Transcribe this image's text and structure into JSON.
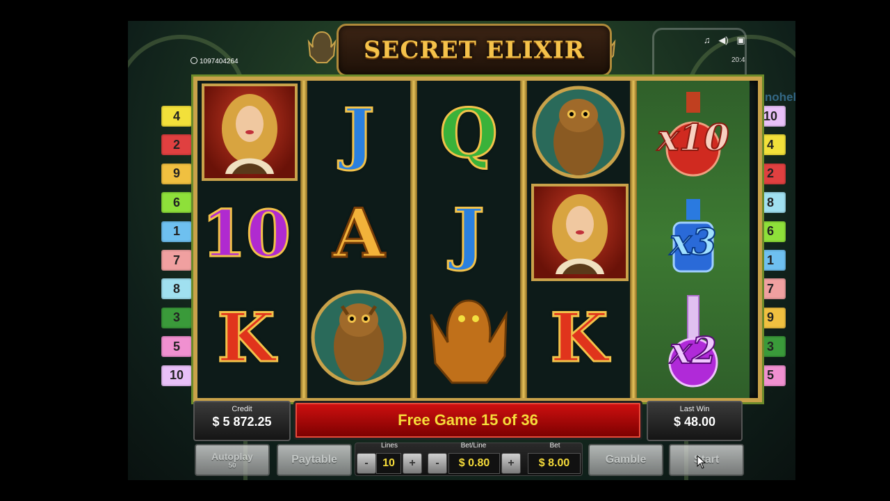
{
  "header": {
    "title": "SECRET ELIXIR",
    "game_id": "1097404264",
    "clock": "20:4",
    "watermark": "Casinoheld.com",
    "icons": [
      "music-icon",
      "speaker-icon",
      "settings-icon"
    ]
  },
  "paylines": {
    "left": [
      "4",
      "2",
      "9",
      "6",
      "1",
      "7",
      "8",
      "3",
      "5",
      "10"
    ],
    "right": [
      "10",
      "4",
      "2",
      "8",
      "6",
      "1",
      "7",
      "9",
      "3",
      "5"
    ],
    "colors": {
      "1": "#6ec0f0",
      "2": "#e04040",
      "3": "#3a9a3a",
      "4": "#f2e03a",
      "5": "#f090d0",
      "6": "#8ee03a",
      "7": "#f0a0a0",
      "8": "#a0e0f0",
      "9": "#f0c040",
      "10": "#e8c0f8"
    }
  },
  "reels": [
    [
      "woman",
      "10",
      "K"
    ],
    [
      "J",
      "A",
      "owl"
    ],
    [
      "Q",
      "J",
      "gargoyle"
    ],
    [
      "owl",
      "woman",
      "K"
    ],
    [
      "x10",
      "x3",
      "x2"
    ]
  ],
  "multipliers": {
    "top": "x10",
    "mid": "x3",
    "bottom": "x2"
  },
  "panel": {
    "credit_label": "Credit",
    "credit_value": "$ 5 872.25",
    "status": "Free Game 15 of 36",
    "last_win_label": "Last Win",
    "last_win_value": "$ 48.00",
    "autoplay_label": "Autoplay",
    "autoplay_count": "50",
    "paytable_label": "Paytable",
    "lines_label": "Lines",
    "lines_value": "10",
    "betline_label": "Bet/Line",
    "betline_value": "$ 0.80",
    "bet_label": "Bet",
    "bet_value": "$ 8.00",
    "gamble_label": "Gamble",
    "start_label": "Start",
    "minus": "-",
    "plus": "+"
  }
}
